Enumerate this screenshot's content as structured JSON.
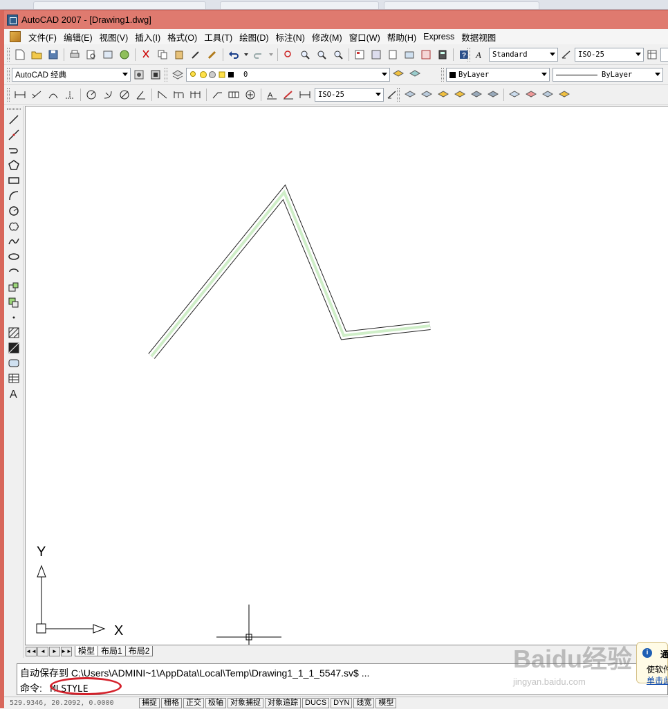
{
  "window": {
    "title": "AutoCAD 2007 - [Drawing1.dwg]"
  },
  "menubar": {
    "items": [
      "文件(F)",
      "编辑(E)",
      "视图(V)",
      "插入(I)",
      "格式(O)",
      "工具(T)",
      "绘图(D)",
      "标注(N)",
      "修改(M)",
      "窗口(W)",
      "帮助(H)",
      "Express",
      "数据视图"
    ]
  },
  "toolbar1": {
    "text_style": "Standard",
    "dim_style": "ISO-25"
  },
  "toolbar2": {
    "workspace": "AutoCAD 经典",
    "layer": "0",
    "color": "ByLayer",
    "linetype": "ByLayer"
  },
  "toolbar3": {
    "dim_style": "ISO-25"
  },
  "canvas": {
    "ucs_y_label": "Y",
    "ucs_x_label": "X"
  },
  "layout_tabs": [
    "模型",
    "布局1",
    "布局2"
  ],
  "command": {
    "history": "自动保存到 C:\\Users\\ADMINI~1\\AppData\\Local\\Temp\\Drawing1_1_1_5547.sv$ ...",
    "prompt": "命令:",
    "input": "MLSTYLE"
  },
  "statusbar": {
    "coordinates": "529.9346, 20.2092, 0.0000",
    "buttons": [
      "捕捉",
      "栅格",
      "正交",
      "极轴",
      "对象捕捉",
      "对象追踪",
      "DUCS",
      "DYN",
      "线宽",
      "模型"
    ]
  },
  "notification": {
    "line1": "通",
    "line2": "使软件",
    "link": "单击此"
  },
  "watermark": {
    "brand": "Baidu经验",
    "url": "jingyan.baidu.com"
  },
  "colors": {
    "title_bar": "#df7a6f",
    "multiline_fill": "#cfeec8",
    "highlight_circle": "#d4202a"
  }
}
